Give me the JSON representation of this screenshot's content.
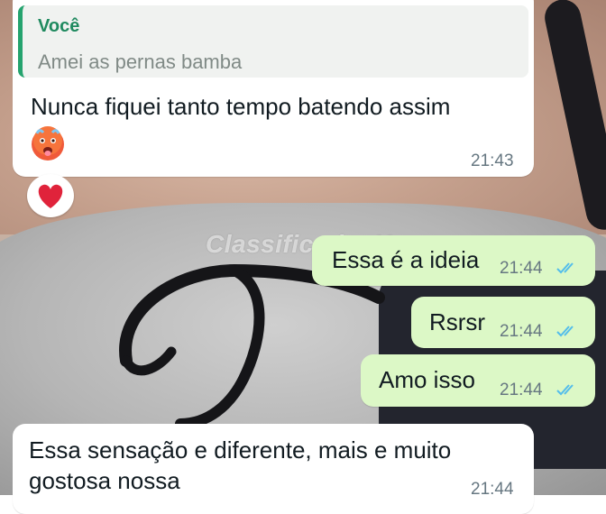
{
  "watermark": "ClassificadosX",
  "messages": [
    {
      "quote_author": "Você",
      "quote_text": "Amei as pernas bamba",
      "text": "Nunca fiquei tanto tempo batendo assim",
      "emoji": "hot-face-emoji",
      "time": "21:43",
      "reaction": "heart-emoji"
    },
    {
      "text": "Essa é a ideia",
      "time": "21:44",
      "status": "read"
    },
    {
      "text": "Rsrsr",
      "time": "21:44",
      "status": "read"
    },
    {
      "text": "Amo isso",
      "time": "21:44",
      "status": "read"
    },
    {
      "text_line1": "Essa sensação e diferente, mais e muito",
      "text_line2": "gostosa nossa",
      "time": "21:44"
    }
  ],
  "colors": {
    "incoming_bubble": "#ffffff",
    "outgoing_bubble": "#dcf8c6",
    "quote_accent": "#25a36e",
    "read_ticks": "#53bdeb",
    "time_text": "#667781"
  }
}
